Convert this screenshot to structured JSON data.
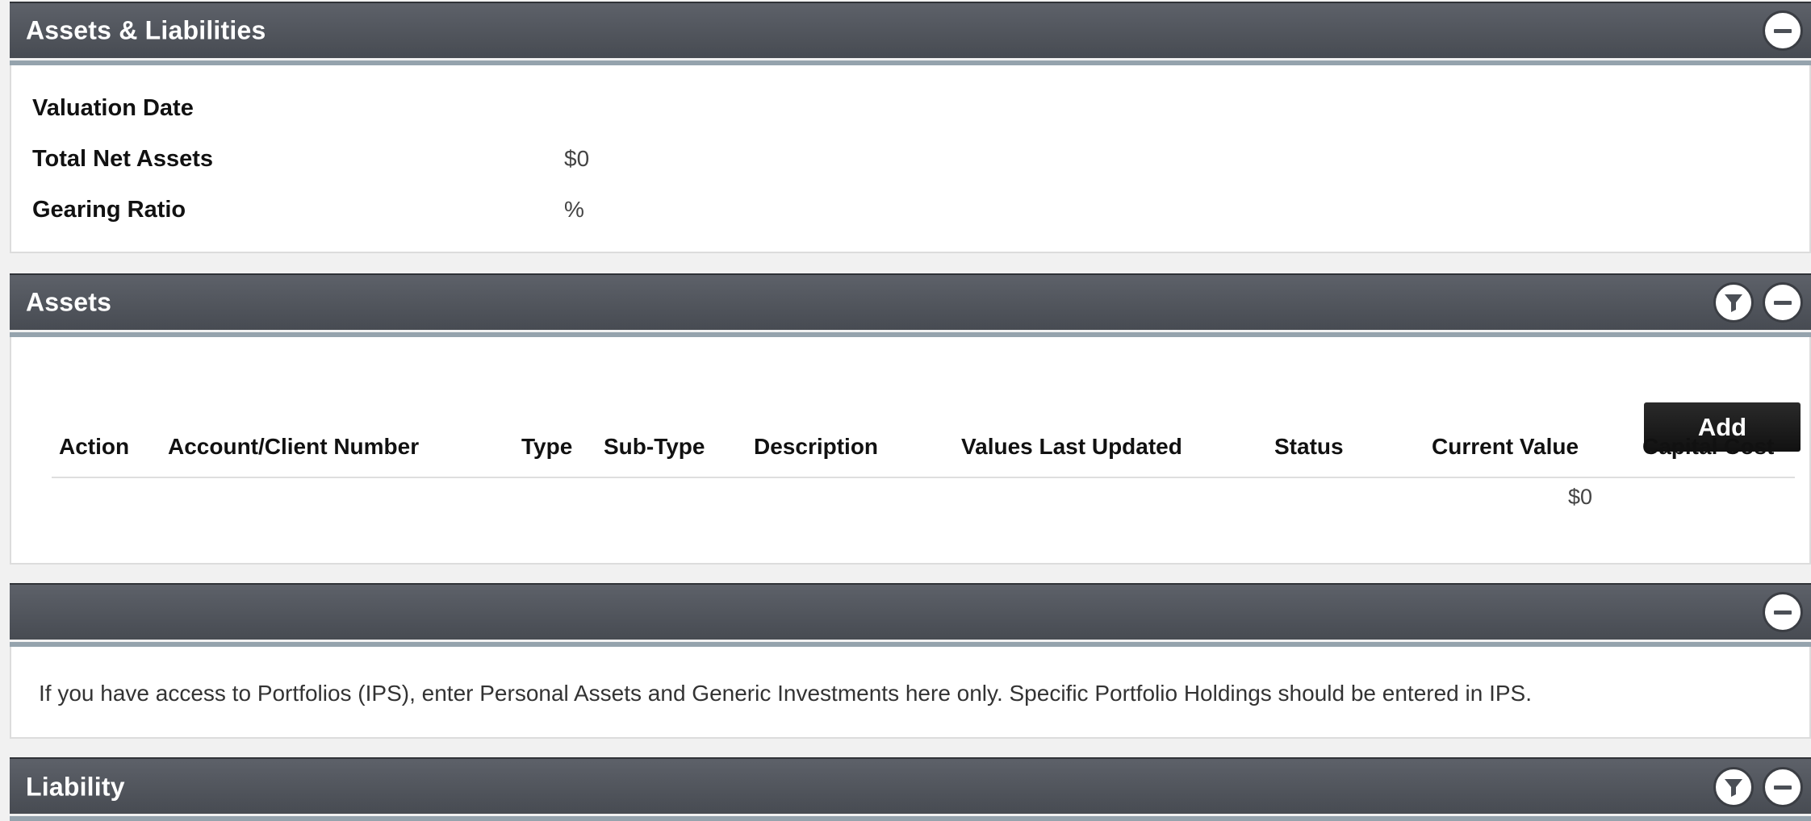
{
  "assets_liabilities": {
    "title": "Assets & Liabilities",
    "rows": [
      {
        "label": "Valuation Date",
        "value": ""
      },
      {
        "label": "Total Net Assets",
        "value": "$0"
      },
      {
        "label": "Gearing Ratio",
        "value": "%"
      }
    ]
  },
  "assets": {
    "title": "Assets",
    "add_label": "Add",
    "columns": [
      "Action",
      "Account/Client Number",
      "Type",
      "Sub-Type",
      "Description",
      "Values Last Updated",
      "Status",
      "Current Value",
      "Capital Cost"
    ],
    "total_row": {
      "current_value": "$0"
    }
  },
  "notice_panel": {
    "title": "",
    "text": "If you have access to Portfolios (IPS), enter Personal Assets and Generic Investments here only. Specific Portfolio Holdings should be entered in IPS."
  },
  "liability": {
    "title": "Liability"
  },
  "icons": {
    "collapse": "minus-circle-icon",
    "filter": "filter-icon"
  }
}
